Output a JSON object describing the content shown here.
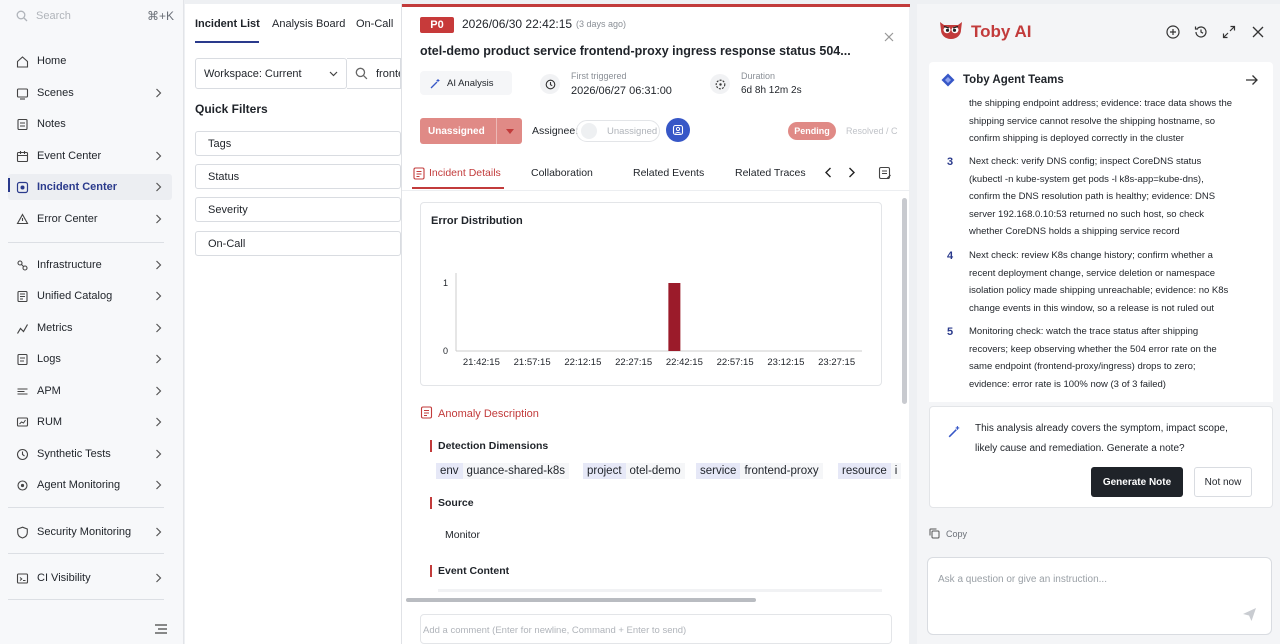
{
  "sidebar": {
    "search_placeholder": "Search",
    "search_shortcut": "⌘+K",
    "items": [
      {
        "label": "Home",
        "icon": "home-icon"
      },
      {
        "label": "Scenes",
        "icon": "scenes-icon"
      },
      {
        "label": "Notes",
        "icon": "notes-icon"
      },
      {
        "label": "Event Center",
        "icon": "event-icon"
      },
      {
        "label": "Incident Center",
        "icon": "incident-icon",
        "active": true
      },
      {
        "label": "Error Center",
        "icon": "error-icon"
      },
      {
        "label": "Infrastructure",
        "icon": "infra-icon"
      },
      {
        "label": "Unified Catalog",
        "icon": "catalog-icon"
      },
      {
        "label": "Metrics",
        "icon": "metrics-icon"
      },
      {
        "label": "Logs",
        "icon": "logs-icon"
      },
      {
        "label": "APM",
        "icon": "apm-icon"
      },
      {
        "label": "RUM",
        "icon": "rum-icon"
      },
      {
        "label": "Synthetic Tests",
        "icon": "synthetic-icon"
      },
      {
        "label": "Agent Monitoring",
        "icon": "agent-icon"
      },
      {
        "label": "Security Monitoring",
        "icon": "security-icon"
      },
      {
        "label": "CI Visibility",
        "icon": "ci-icon"
      }
    ]
  },
  "list_panel": {
    "tabs": [
      "Incident List",
      "Analysis Board",
      "On-Call"
    ],
    "workspace": "Workspace: Current",
    "search_value": "frontend",
    "quick_filters_title": "Quick Filters",
    "filters": [
      "Tags",
      "Status",
      "Severity",
      "On-Call"
    ]
  },
  "incident": {
    "severity": "P0",
    "date": "2026/06/30 22:42:15",
    "ago": "(3 days ago)",
    "title": "otel-demo product service frontend-proxy ingress response status 504...",
    "ai_analysis": "AI Analysis",
    "first_triggered_label": "First triggered",
    "first_triggered_value": "2026/06/27 06:31:00",
    "duration_label": "Duration",
    "duration_value": "6d 8h 12m 2s",
    "status_button": "Unassigned",
    "assignee_label": "Assignee:",
    "assignee_value": "Unassigned",
    "status_pending": "Pending",
    "status_resolved": "Resolved / C",
    "tabs": [
      "Incident Details",
      "Collaboration",
      "Related Events",
      "Related Traces"
    ],
    "anomaly_title": "Anomaly Description",
    "detection_dimensions": "Detection Dimensions",
    "dimensions": [
      {
        "key": "env",
        "value": "guance-shared-k8s"
      },
      {
        "key": "project",
        "value": "otel-demo"
      },
      {
        "key": "service",
        "value": "frontend-proxy"
      },
      {
        "key": "resource",
        "value": "i"
      }
    ],
    "source_title": "Source",
    "source_value": "Monitor",
    "event_content_title": "Event Content",
    "comment_placeholder": "Add a comment (Enter for newline, Command + Enter to send)"
  },
  "chart_data": {
    "type": "bar",
    "title": "Error Distribution",
    "categories": [
      "21:42:15",
      "21:57:15",
      "22:12:15",
      "22:27:15",
      "22:42:15",
      "22:57:15",
      "23:12:15",
      "23:27:15"
    ],
    "x_ticks": [
      "21:42:15",
      "21:57:15",
      "22:12:15",
      "22:27:15",
      "22:42:15",
      "22:57:15",
      "23:12:15",
      "23:27:15"
    ],
    "bars": [
      {
        "x": "22:42:15",
        "value": 1
      }
    ],
    "ylim": [
      0,
      1
    ],
    "y_ticks": [
      "0",
      "1"
    ],
    "bar_color": "#9b1b2a",
    "grid": false
  },
  "toby": {
    "title": "Toby AI",
    "teams_label": "Toby Agent Teams",
    "intro_text": "the shipping endpoint address; evidence: trace data shows the shipping service cannot resolve the shipping hostname, so confirm shipping is deployed correctly in the cluster",
    "steps": [
      {
        "num": "3",
        "text": "Next check: verify DNS config; inspect CoreDNS status (kubectl -n kube-system get pods -l k8s-app=kube-dns), confirm the DNS resolution path is healthy; evidence: DNS server 192.168.0.10:53 returned no such host, so check whether CoreDNS holds a shipping service record"
      },
      {
        "num": "4",
        "text": "Next check: review K8s change history; confirm whether a recent deployment change, service deletion or namespace isolation policy made shipping unreachable; evidence: no K8s change events in this window, so a release is not ruled out"
      },
      {
        "num": "5",
        "text": "Monitoring check: watch the trace status after shipping recovers; keep observing whether the 504 error rate on the same endpoint (frontend-proxy/ingress) drops to zero; evidence: error rate is 100% now (3 of 3 failed)"
      }
    ],
    "suggestion_text": "This analysis already covers the symptom, impact scope, likely cause and remediation. Generate a note?",
    "generate_button": "Generate Note",
    "not_now_button": "Not now",
    "copy_label": "Copy",
    "input_placeholder": "Ask a question or give an instruction..."
  }
}
